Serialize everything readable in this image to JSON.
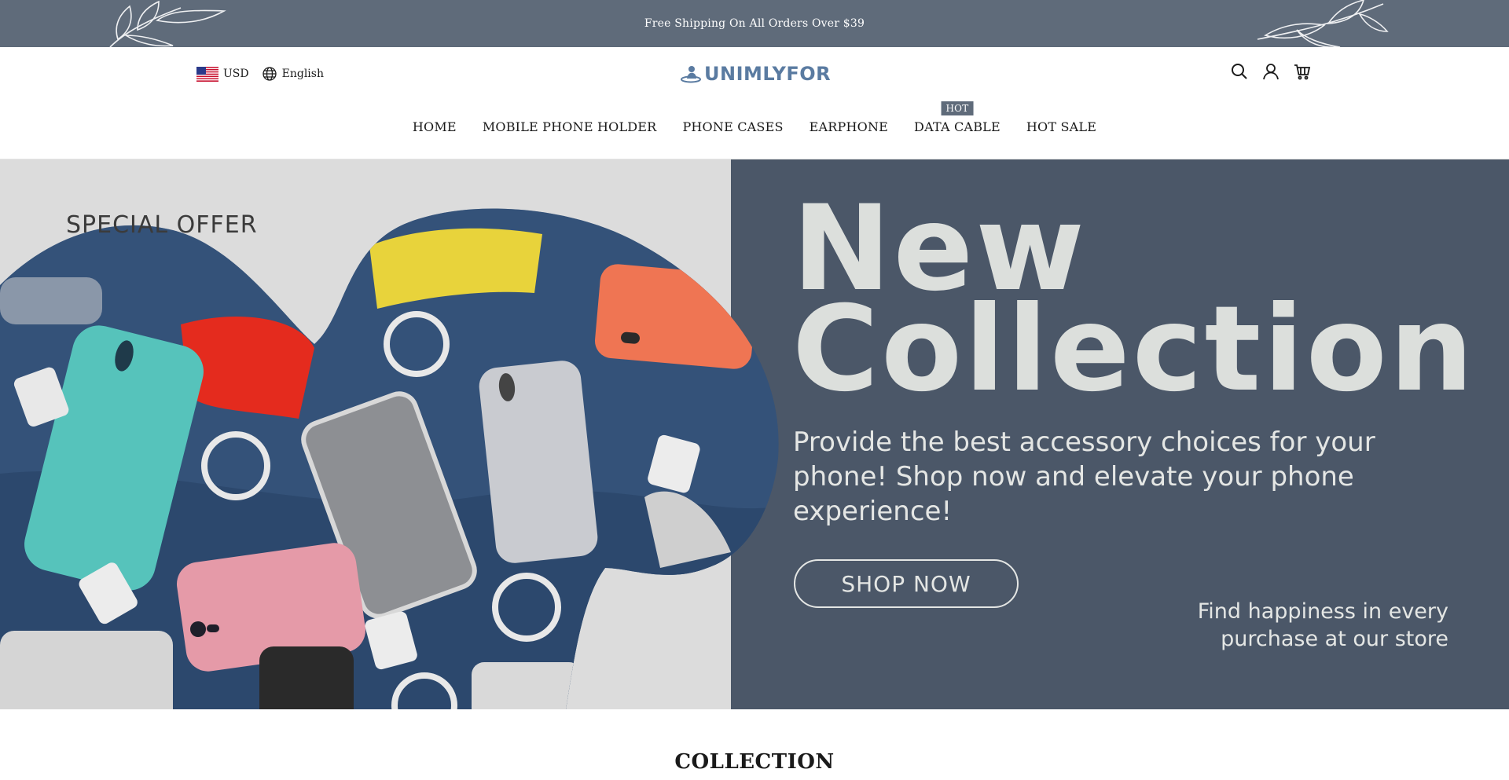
{
  "announcement": {
    "text": "Free Shipping On All Orders Over $39"
  },
  "header": {
    "currency": "USD",
    "language": "English",
    "logo_text": "UNIMLYFOR",
    "icons": [
      "search-icon",
      "account-icon",
      "cart-icon"
    ]
  },
  "nav": {
    "items": [
      {
        "label": "HOME"
      },
      {
        "label": "MOBILE PHONE HOLDER"
      },
      {
        "label": "PHONE CASES"
      },
      {
        "label": "EARPHONE"
      },
      {
        "label": "DATA CABLE",
        "badge": "HOT"
      },
      {
        "label": "HOT SALE"
      }
    ]
  },
  "hero": {
    "eyebrow": "SPECIAL OFFER",
    "title_line1": "New",
    "title_line2": "Collection",
    "subtitle": "Provide the best accessory choices for your phone! Shop now and elevate your phone experience!",
    "cta": "SHOP NOW",
    "tagline_line1": "Find happiness in every",
    "tagline_line2": "purchase at our store"
  },
  "section": {
    "heading": "COLLECTION"
  },
  "colors": {
    "announce_bg": "#5f6b7a",
    "hero_dark_bg": "#4b5768",
    "hero_light_bg": "#dcdcdc",
    "logo": "#5a7ba1",
    "badge_bg": "#5f6b7a"
  }
}
